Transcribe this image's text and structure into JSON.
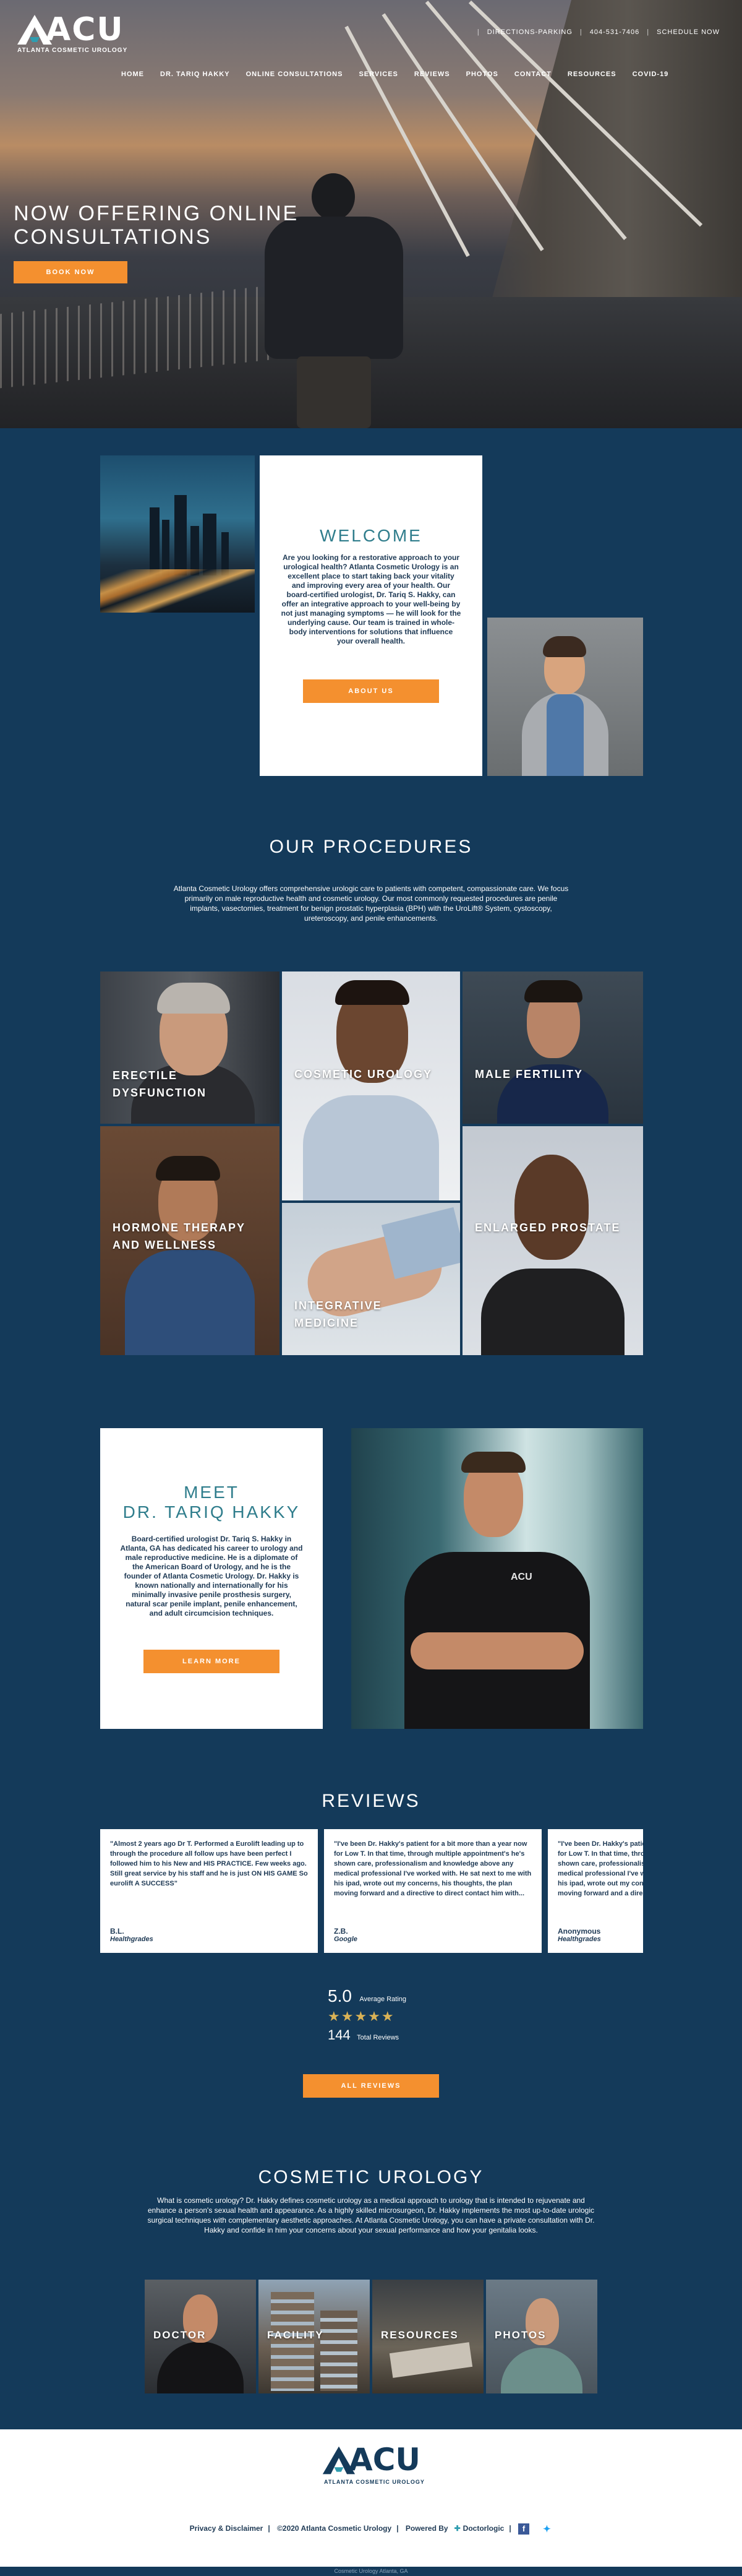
{
  "brand": {
    "logo_text": "ACU",
    "logo_sub": "ATLANTA COSMETIC UROLOGY"
  },
  "topbar": {
    "directions": "DIRECTIONS-PARKING",
    "phone": "404-531-7406",
    "schedule": "SCHEDULE NOW"
  },
  "nav": [
    "HOME",
    "DR. TARIQ HAKKY",
    "ONLINE CONSULTATIONS",
    "SERVICES",
    "REVIEWS",
    "PHOTOS",
    "CONTACT",
    "RESOURCES",
    "COVID-19"
  ],
  "hero": {
    "headline": "NOW OFFERING ONLINE CONSULTATIONS",
    "button": "BOOK NOW"
  },
  "welcome": {
    "title": "WELCOME",
    "text": "Are you looking for a restorative approach to your urological health? Atlanta Cosmetic Urology is an excellent place to start taking back your vitality and improving every area of your health. Our board-certified urologist, Dr. Tariq S. Hakky, can offer an integrative approach to your well-being by not just managing symptoms — he will look for the underlying cause. Our team is trained in whole-body interventions for solutions that influence your overall health.",
    "button": "ABOUT US"
  },
  "procedures": {
    "title": "OUR PROCEDURES",
    "text": "Atlanta Cosmetic Urology offers comprehensive urologic care to patients with competent, compassionate care. We focus primarily on male reproductive health and cosmetic urology. Our most commonly requested procedures are penile implants, vasectomies, treatment for benign prostatic hyperplasia (BPH) with the UroLift® System, cystoscopy, ureteroscopy, and penile enhancements.",
    "tiles": [
      {
        "label_line1": "ERECTILE",
        "label_line2": "DYSFUNCTION"
      },
      {
        "label_line1": "COSMETIC UROLOGY",
        "label_line2": ""
      },
      {
        "label_line1": "MALE FERTILITY",
        "label_line2": ""
      },
      {
        "label_line1": "HORMONE THERAPY",
        "label_line2": "AND WELLNESS"
      },
      {
        "label_line1": "INTEGRATIVE",
        "label_line2": "MEDICINE"
      },
      {
        "label_line1": "ENLARGED PROSTATE",
        "label_line2": ""
      }
    ]
  },
  "meet": {
    "title_line1": "MEET",
    "title_line2": "DR. TARIQ HAKKY",
    "text": "Board-certified urologist Dr. Tariq S. Hakky in Atlanta, GA has dedicated his career to urology and male reproductive medicine. He is a diplomate of the American Board of Urology, and he is the founder of Atlanta Cosmetic Urology. Dr. Hakky is known nationally and internationally for his minimally invasive penile prosthesis surgery, natural scar penile implant, penile enhancement, and adult circumcision techniques.",
    "button": "LEARN MORE",
    "scrub_logo": "ACU"
  },
  "reviews": {
    "title": "REVIEWS",
    "items": [
      {
        "text": "\"Almost 2 years ago Dr T. Performed a Eurolift leading up to through the procedure all follow ups have been perfect I followed him to his New and HIS PRACTICE. Few weeks ago. Still great service by his staff and he is just ON HIS GAME So eurolift A SUCCESS\"",
        "name": "B.L.",
        "source": "Healthgrades"
      },
      {
        "text": "\"I've been Dr. Hakky's patient for a bit more than a year now for Low T. In that time, through multiple appointment's he's shown care, professionalism and knowledge above any medical professional I've worked with. He sat next to me with his ipad, wrote out my concerns, his thoughts, the plan moving forward and a directive to direct contact him with...",
        "name": "Z.B.",
        "source": "Google"
      },
      {
        "text": "\"I've been Dr. Hakky's patient for a bit more than a year now for Low T. In that time, through multiple appointment's he's shown care, professionalism and knowledge above any medical professional I've worked with. He sat next to me with his ipad, wrote out my concerns, his thoughts, the plan moving forward and a directive to direct contact him with...",
        "name": "Anonymous",
        "source": "Healthgrades"
      }
    ],
    "rating": "5.0",
    "rating_label": "Average Rating",
    "stars": "★★★★★",
    "total": "144",
    "total_label": "Total Reviews",
    "button": "ALL REVIEWS"
  },
  "cosmetic": {
    "title": "COSMETIC UROLOGY",
    "text": "What is cosmetic urology? Dr. Hakky defines cosmetic urology as a medical approach to urology that is intended to rejuvenate and enhance a person's sexual health and appearance. As a highly skilled microsurgeon, Dr. Hakky implements the most up-to-date urologic surgical techniques with complementary aesthetic approaches. At Atlanta Cosmetic Urology, you can have a private consultation with Dr. Hakky and confide in him your concerns about your sexual performance and how your genitalia looks.",
    "tiles": [
      "DOCTOR",
      "FACILITY",
      "RESOURCES",
      "PHOTOS"
    ]
  },
  "footer": {
    "logo_text": "ACU",
    "logo_sub": "ATLANTA COSMETIC UROLOGY",
    "privacy": "Privacy & Disclaimer",
    "copyright": "©2020 Atlanta Cosmetic Urology",
    "powered": "Powered By",
    "doctorlogic": "Doctorlogic",
    "bottom": "Cosmetic Urology Atlanta, GA"
  },
  "colors": {
    "navy": "#143a5a",
    "orange": "#f4902f",
    "teal": "#2f7d8c"
  }
}
